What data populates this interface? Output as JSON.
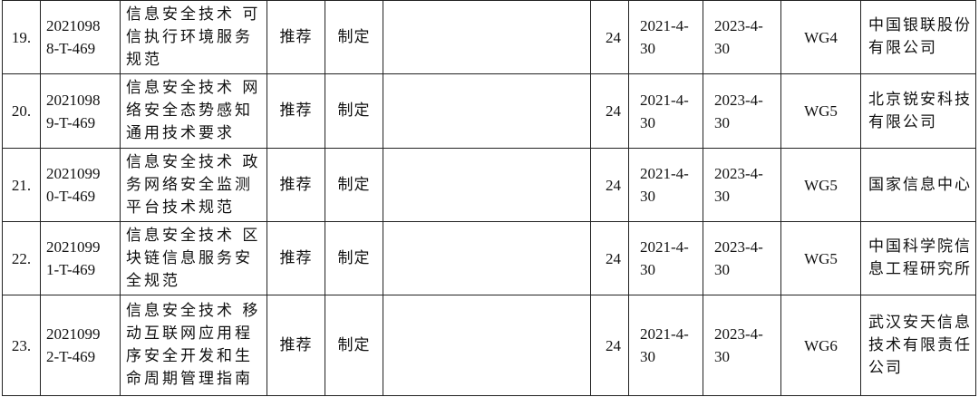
{
  "rows": [
    {
      "no": "19.",
      "code_lines": [
        "2021098",
        "8-T-469"
      ],
      "name_lines": [
        "信息安全技术 可",
        "信执行环境服务",
        "规范"
      ],
      "nature": "推荐",
      "type": "制定",
      "blank": "",
      "period": "24",
      "start_lines": [
        "2021-4-",
        "30"
      ],
      "end_lines": [
        "2023-4-",
        "30"
      ],
      "wg": "WG4",
      "org_lines": [
        "中国银联股份",
        "有限公司"
      ]
    },
    {
      "no": "20.",
      "code_lines": [
        "2021098",
        "9-T-469"
      ],
      "name_lines": [
        "信息安全技术 网",
        "络安全态势感知",
        "通用技术要求"
      ],
      "nature": "推荐",
      "type": "制定",
      "blank": "",
      "period": "24",
      "start_lines": [
        "2021-4-",
        "30"
      ],
      "end_lines": [
        "2023-4-",
        "30"
      ],
      "wg": "WG5",
      "org_lines": [
        "北京锐安科技",
        "有限公司"
      ]
    },
    {
      "no": "21.",
      "code_lines": [
        "2021099",
        "0-T-469"
      ],
      "name_lines": [
        "信息安全技术 政",
        "务网络安全监测",
        "平台技术规范"
      ],
      "nature": "推荐",
      "type": "制定",
      "blank": "",
      "period": "24",
      "start_lines": [
        "2021-4-",
        "30"
      ],
      "end_lines": [
        "2023-4-",
        "30"
      ],
      "wg": "WG5",
      "org_lines": [
        "国家信息中心"
      ]
    },
    {
      "no": "22.",
      "code_lines": [
        "2021099",
        "1-T-469"
      ],
      "name_lines": [
        "信息安全技术 区",
        "块链信息服务安",
        "全规范"
      ],
      "nature": "推荐",
      "type": "制定",
      "blank": "",
      "period": "24",
      "start_lines": [
        "2021-4-",
        "30"
      ],
      "end_lines": [
        "2023-4-",
        "30"
      ],
      "wg": "WG5",
      "org_lines": [
        "中国科学院信",
        "息工程研究所"
      ]
    },
    {
      "no": "23.",
      "code_lines": [
        "2021099",
        "2-T-469"
      ],
      "name_lines": [
        "信息安全技术 移",
        "动互联网应用程",
        "序安全开发和生",
        "命周期管理指南"
      ],
      "nature": "推荐",
      "type": "制定",
      "blank": "",
      "period": "24",
      "start_lines": [
        "2021-4-",
        "30"
      ],
      "end_lines": [
        "2023-4-",
        "30"
      ],
      "wg": "WG6",
      "org_lines": [
        "武汉安天信息",
        "技术有限责任",
        "公司"
      ]
    }
  ]
}
